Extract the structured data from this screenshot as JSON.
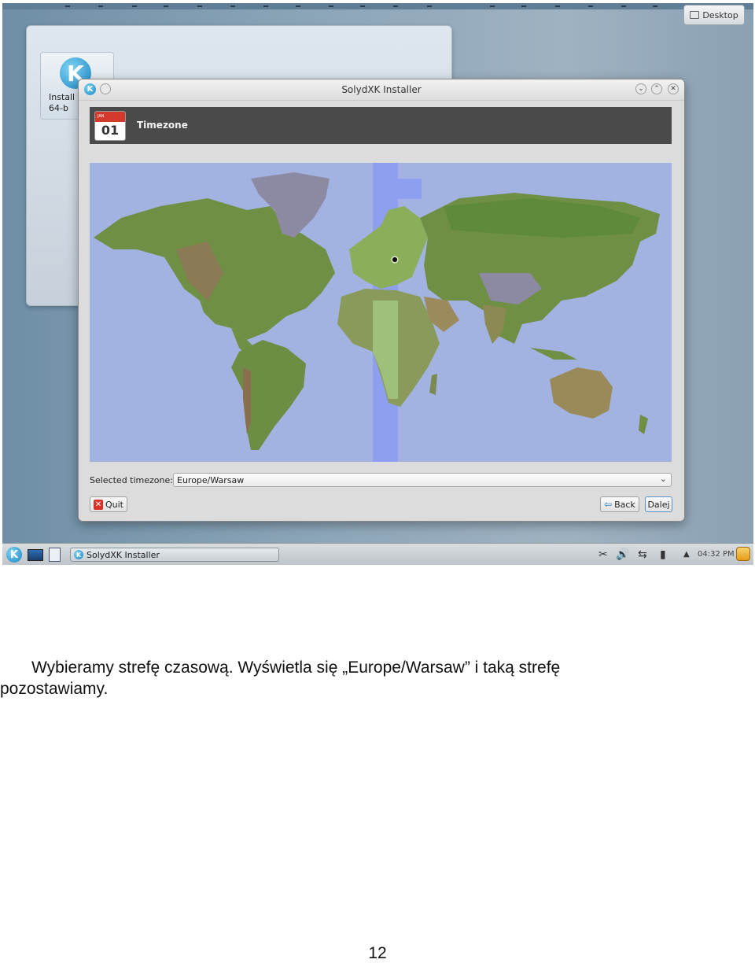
{
  "desktop": {
    "button_label": "Desktop"
  },
  "background_window": {
    "tile_label": "Install S\n64-b"
  },
  "installer": {
    "title": "SolydXK Installer",
    "header": {
      "title": "Timezone",
      "calendar_month": "JAN",
      "calendar_day": "01"
    },
    "timezone": {
      "label": "Selected timezone:",
      "value": "Europe/Warsaw"
    },
    "buttons": {
      "quit": "Quit",
      "back": "Back",
      "next": "Dalej"
    },
    "map": {
      "ocean_color": "#a3b3e1",
      "highlight_color": "#8f9ff0",
      "selected_city": "Warsaw"
    }
  },
  "taskbar": {
    "task_label": "SolydXK Installer",
    "clock": "04:32 PM",
    "tray_icons": [
      "scissors-icon",
      "volume-icon",
      "network-icon",
      "battery-icon",
      "up-arrow-icon"
    ]
  },
  "caption": {
    "line1": "Wybieramy strefę czasową. Wyświetla się „Europe/Warsaw” i taką strefę",
    "line2": "pozostawiamy."
  },
  "page_number": "12"
}
